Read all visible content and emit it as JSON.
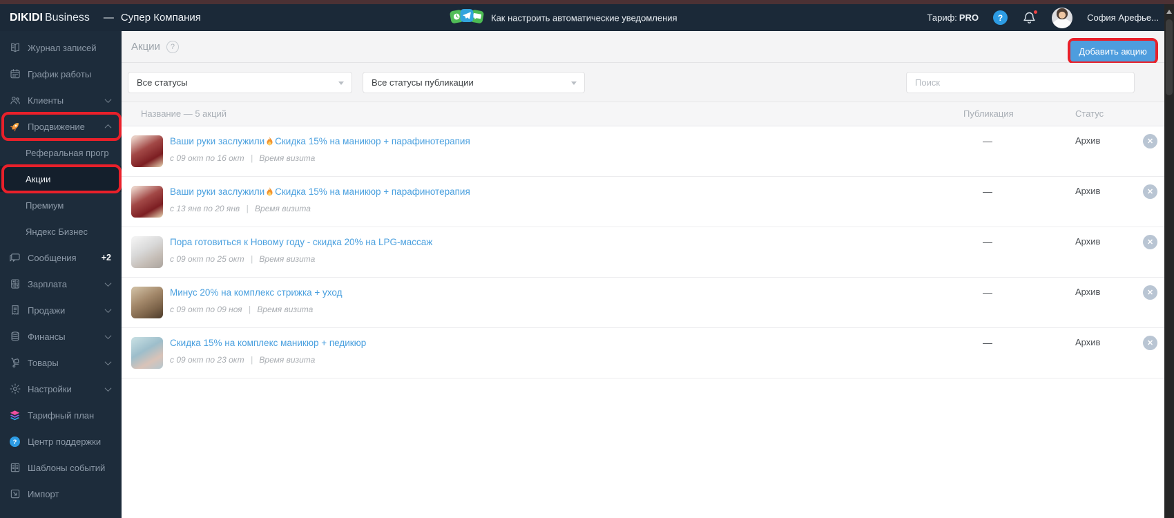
{
  "header": {
    "logo_primary": "DIKIDI",
    "logo_secondary": "Business",
    "divider": "—",
    "company_name": "Супер Компания",
    "promo_link": "Как настроить автоматические уведомления",
    "tariff_label": "Тариф:",
    "tariff_value": "PRO",
    "help_glyph": "?",
    "user_name": "София Арефье..."
  },
  "sidebar": {
    "items": [
      {
        "id": "journal",
        "label": "Журнал записей",
        "icon": "journal"
      },
      {
        "id": "schedule",
        "label": "График работы",
        "icon": "calendar"
      },
      {
        "id": "clients",
        "label": "Клиенты",
        "icon": "clients",
        "chevron": "down"
      },
      {
        "id": "promotion",
        "label": "Продвижение",
        "icon": "rocket",
        "chevron": "up",
        "highlighted": true
      },
      {
        "id": "referral",
        "label": "Реферальная прогр",
        "sub": true
      },
      {
        "id": "promos",
        "label": "Акции",
        "sub": true,
        "active": true,
        "highlighted": true
      },
      {
        "id": "premium",
        "label": "Премиум",
        "sub": true
      },
      {
        "id": "yandex",
        "label": "Яндекс Бизнес",
        "sub": true
      },
      {
        "id": "messages",
        "label": "Сообщения",
        "icon": "messages",
        "badge": "+2"
      },
      {
        "id": "salary",
        "label": "Зарплата",
        "icon": "salary",
        "chevron": "down"
      },
      {
        "id": "sales",
        "label": "Продажи",
        "icon": "sales",
        "chevron": "down"
      },
      {
        "id": "finance",
        "label": "Финансы",
        "icon": "finance",
        "chevron": "down"
      },
      {
        "id": "goods",
        "label": "Товары",
        "icon": "goods",
        "chevron": "down"
      },
      {
        "id": "settings",
        "label": "Настройки",
        "icon": "settings",
        "chevron": "down"
      },
      {
        "id": "tariff-plan",
        "label": "Тарифный план",
        "icon": "tariff"
      },
      {
        "id": "support",
        "label": "Центр поддержки",
        "icon": "support"
      },
      {
        "id": "templates",
        "label": "Шаблоны событий",
        "icon": "templates"
      },
      {
        "id": "import",
        "label": "Импорт",
        "icon": "import"
      }
    ]
  },
  "main": {
    "page_title": "Акции",
    "title_help_glyph": "?",
    "add_button_label": "Добавить акцию",
    "filters": {
      "status_filter": "Все статусы",
      "publication_filter": "Все статусы публикации",
      "search_placeholder": "Поиск"
    },
    "table": {
      "name_header": "Название — 5 акций",
      "publication_header": "Публикация",
      "status_header": "Статус",
      "rows": [
        {
          "title_pre": "Ваши руки заслужили",
          "has_fire": true,
          "title_post": " Скидка 15% на маникюр + парафинотерапия",
          "dates": "с 09 окт по 16 окт",
          "separator": "|",
          "visit_label": "Время визита",
          "publication": "—",
          "status": "Архив",
          "thumb": "manicure-paraffin",
          "thumb_gradient": [
            "#e8cdc3",
            "#a24846",
            "#7c1e22",
            "#ead9b6"
          ]
        },
        {
          "title_pre": "Ваши руки заслужили",
          "has_fire": true,
          "title_post": " Скидка 15% на маникюр + парафинотерапия",
          "dates": "с 13 янв по 20 янв",
          "separator": "|",
          "visit_label": "Время визита",
          "publication": "—",
          "status": "Архив",
          "thumb": "manicure-paraffin",
          "thumb_gradient": [
            "#e8cdc3",
            "#a24846",
            "#7c1e22",
            "#ead9b6"
          ]
        },
        {
          "title_pre": "Пора готовиться к Новому году - скидка 20% на LPG-массаж",
          "has_fire": false,
          "title_post": "",
          "dates": "с 09 окт по 25 окт",
          "separator": "|",
          "visit_label": "Время визита",
          "publication": "—",
          "status": "Архив",
          "thumb": "lpg-massage",
          "thumb_gradient": [
            "#f1f1f1",
            "#d9d9d9",
            "#c4bcb5",
            "#aba49e"
          ]
        },
        {
          "title_pre": "Минус 20% на комплекс стрижка + уход",
          "has_fire": false,
          "title_post": "",
          "dates": "с 09 окт по 09 ноя",
          "separator": "|",
          "visit_label": "Время визита",
          "publication": "—",
          "status": "Архив",
          "thumb": "haircut-care",
          "thumb_gradient": [
            "#cbb99d",
            "#a3886a",
            "#7c6349",
            "#4d3c2b"
          ]
        },
        {
          "title_pre": "Скидка 15% на комплекс маникюр + педикюр",
          "has_fire": false,
          "title_post": "",
          "dates": "с 09 окт по 23 окт",
          "separator": "|",
          "visit_label": "Время визита",
          "publication": "—",
          "status": "Архив",
          "thumb": "manicure-pedicure",
          "thumb_gradient": [
            "#c2dbe0",
            "#9dbecb",
            "#d9c3b8",
            "#b4c7cf"
          ]
        }
      ]
    }
  },
  "colors": {
    "highlight_red": "#e9202a",
    "accent_blue": "#4e9dde",
    "link_blue": "#4aa0df",
    "topbar_bg": "#1b2938",
    "sidebar_bg": "#1d2c3b",
    "sidebar_active_bg": "#141f2c",
    "filter_bg": "#f4f4f5",
    "status_text": "#4b4f54",
    "muted_text": "#a8aeb5"
  }
}
